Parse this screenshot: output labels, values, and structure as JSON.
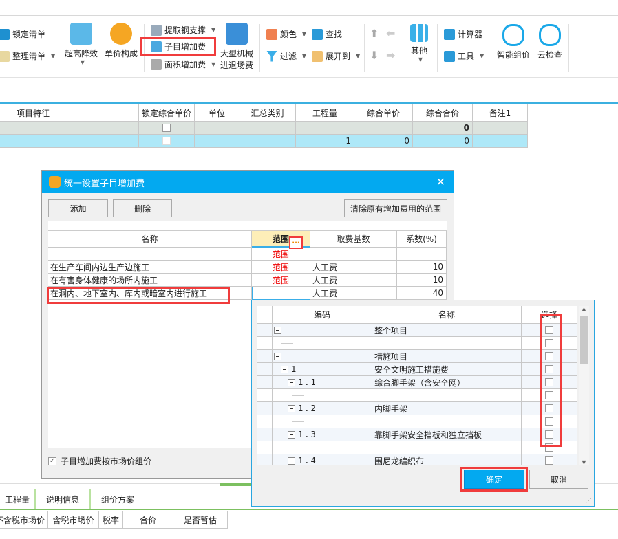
{
  "toolbar": {
    "lock_list": "锁定清单",
    "organize_list": "整理清单",
    "super_high": "超高降效",
    "unit_price": "单价构成",
    "extract_steel": "提取钢支撑",
    "sub_item_fee": "子目增加费",
    "area_fee": "面积增加费",
    "machinery_1": "大型机械",
    "machinery_2": "进退场费",
    "color": "颜色",
    "filter": "过滤",
    "find": "查找",
    "expand_to": "展开到",
    "other": "其他",
    "calculator": "计算器",
    "tools": "工具",
    "smart_price": "智能组价",
    "cloud_check": "云检查"
  },
  "main_table": {
    "columns": [
      "项目特征",
      "锁定综合单价",
      "单位",
      "汇总类别",
      "工程量",
      "综合单价",
      "综合合价",
      "备注1"
    ],
    "rows": [
      [
        "",
        "",
        "",
        "",
        "",
        "",
        "0",
        ""
      ],
      [
        "",
        "",
        "",
        "",
        "1",
        "0",
        "0",
        ""
      ]
    ]
  },
  "dialog": {
    "title": "统一设置子目增加费",
    "add": "添加",
    "delete": "删除",
    "clear_range": "清除原有增加费用的范围",
    "columns": [
      "名称",
      "范围",
      "取费基数",
      "系数(%)"
    ],
    "rows": [
      {
        "name": "",
        "range": "范围",
        "base": "",
        "coef": ""
      },
      {
        "name": "在生产车间内边生产边施工",
        "range": "范围",
        "base": "人工费",
        "coef": "10"
      },
      {
        "name": "在有害身体健康的场所内施工",
        "range": "范围",
        "base": "人工费",
        "coef": "10"
      },
      {
        "name": "在洞内、地下室内、库内或暗室内进行施工",
        "range": "",
        "base": "人工费",
        "coef": "40"
      }
    ],
    "ellipsis": "···",
    "market_price_checkbox": "子目增加费按市场价组价",
    "market_price_checked": true
  },
  "popup": {
    "columns": [
      "编码",
      "名称",
      "选择"
    ],
    "rows": [
      {
        "code": "",
        "name": "整个项目",
        "expander": true,
        "level": 0
      },
      {
        "code": "",
        "name": "",
        "expander": false,
        "level": 1
      },
      {
        "code": "",
        "name": "措施项目",
        "expander": true,
        "level": 0
      },
      {
        "code": "1",
        "name": "安全文明施工措施费",
        "expander": true,
        "level": 1
      },
      {
        "code": "1.1",
        "name": "综合脚手架（含安全网）",
        "expander": true,
        "level": 2
      },
      {
        "code": "",
        "name": "",
        "expander": false,
        "level": 3
      },
      {
        "code": "1.2",
        "name": "内脚手架",
        "expander": true,
        "level": 2
      },
      {
        "code": "",
        "name": "",
        "expander": false,
        "level": 3
      },
      {
        "code": "1.3",
        "name": "靠脚手架安全挡板和独立挡板",
        "expander": true,
        "level": 2
      },
      {
        "code": "",
        "name": "",
        "expander": false,
        "level": 3
      },
      {
        "code": "1.4",
        "name": "围尼龙编织布",
        "expander": true,
        "level": 2
      }
    ],
    "ok": "确定",
    "cancel": "取消"
  },
  "bottom_tabs": [
    "工程量",
    "说明信息",
    "组价方案"
  ],
  "bottom_columns": [
    "不含税市场价",
    "含税市场价",
    "税率",
    "合价",
    "是否暂估"
  ],
  "colors": {
    "accent": "#03a9f0",
    "highlight": "#f03c3c",
    "row_selected": "#aee8f8",
    "row_gray": "#dce3de"
  }
}
